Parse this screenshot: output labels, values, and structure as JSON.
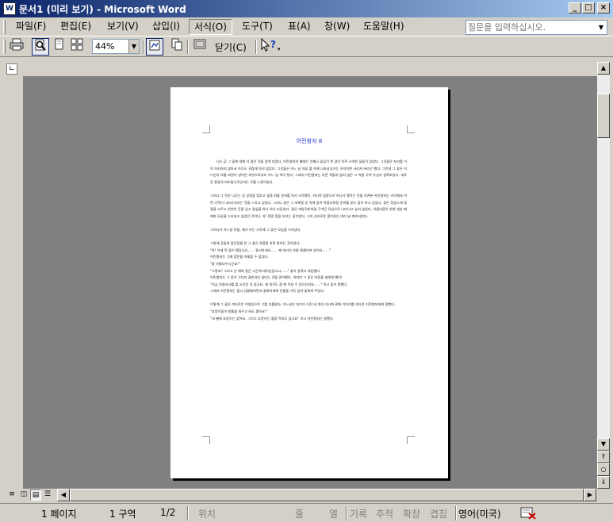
{
  "window": {
    "title": "문서1 (미리 보기) - Microsoft Word",
    "app_icon": "W"
  },
  "menubar": {
    "items": [
      "파일(F)",
      "편집(E)",
      "보기(V)",
      "삽입(I)",
      "서식(O)",
      "도구(T)",
      "표(A)",
      "창(W)",
      "도움말(H)"
    ],
    "active_item": "서식(O)",
    "ask_placeholder": "질문을 입력하십시오."
  },
  "toolbar": {
    "zoom": "44%",
    "close_label": "닫기(C)",
    "icons": [
      "print-icon",
      "magnifier-icon",
      "one-page-icon",
      "multiple-pages-icon",
      "shrink-to-fit-icon",
      "full-screen-icon",
      "help-cursor-icon"
    ]
  },
  "document": {
    "title": "어린왕자 8",
    "paragraphs": [
      "나는 곧 그 꽃에 대해 더 많은 것을 알게 되었다. 어린왕자의 별에는 언제나 꽃잎이 한 겹인 아주 소박한 꽃들이 있었다. 그것들은 자리를 거의 차지하지 않아서 아무도 귀찮게 하지 않았다. 그것들은 어느 날 아침 풀 속에 나타났다가는 저녁이면 사라져 버리곤 했다. 그런데 그 꽃은 어디선지 모를 씨앗이 날아온 씨앗으로부터 어느 날 싹이 텄다. 그래서 어린왕자는 다른 싹들과 닮지 않은 그 싹을 무척 유심히 살펴보았다. 새로운 종류의 바오밥나무인지도 모를 노릇이었다.",
      "그러나 그 작은 나무는 곧 성장을 멈추고 꽃을 피울 준비를 하기 시작했다. 커다란 꽃봉오리 하나가 맺히는 것을 지켜본 어린왕자는 거기에서 어떤 기적이 나타나리라는 것을 느끼고 있었다. 그러나 꽃은 그 초록빛 방 속에 숨어 아름다워질 준비를 끝도 없이 하고 있었다. 꽃은 정성스레 빛깔을 고르고 천천히 옷을 입고 꽃잎을 하나 하나 다듬었다. 꽃은 개양귀비처럼 구겨진 모습으로 나타나고 싶지 않았다. 아름다움이 한창 빛날 때에야 모습을 드러내고 싶었던 것이다. 아! 정말 멋을 부리는 꽃이었다. 그의 신비로운 몸치장은 여러 날 계속되었다.",
      "그러다가 어느날 아침, 해가 뜨는 시각에 그 꽃은 모습을 드러냈다.",
      "그렇게 공들여 몸단장을 한 그 꽃은 하품을 하며 말하는 것이었다.",
      "\"아! 이제 막 잠이 깼답니다…… 용서하세요…… 제 머리가 온통 헝클어져 있어요……\"",
      "어린왕자는 그때 감탄을 억제할 수 없었다.",
      "\"참 아름다우시군요!\"",
      "\"그렇죠? 그리고 난 해와 같은 시간에 태어났답니다……\" 꽃이 살며시 대답했다.",
      "어린왕자는 그 꽃이 그다지 겸손하지 않다는 것을 알아챘다. 하지만 그 꽃은 마음을 설레게 했다!",
      "\"지금 아침식사를 할 시간인 것 같군요. 제 생각도 좀 해 주실 수 있으신지요……\" 하고 꽃이 말했다.",
      "그래서 어린왕자는 몹시 당황해하면서 물뿌리개에 찬물을 가득 담아 꽃에게 주었다.",
      "이렇게 그 꽃은 까다로운 허영심으로 그를 괴롭혔다. 어느날은 자기가 가진 네 개의 가시에 관해 이야기를 하다가 어린왕자에게 말했다.",
      "\"호랑이들이 발톱을 세우고 와도 좋아요!\"",
      "\"내 별에 호랑이는 없어요. 그리고 호랑이는 풀을 먹지도 않고요\" 라고 어린왕자는 말했다."
    ]
  },
  "status": {
    "page": "1 페이지",
    "section": "1 구역",
    "page_of": "1/2",
    "position": "위치",
    "line": "줄",
    "column": "열",
    "rec": "기록",
    "trk": "추적",
    "ext": "확장",
    "ovr": "겹침",
    "language": "영어(미국)"
  }
}
